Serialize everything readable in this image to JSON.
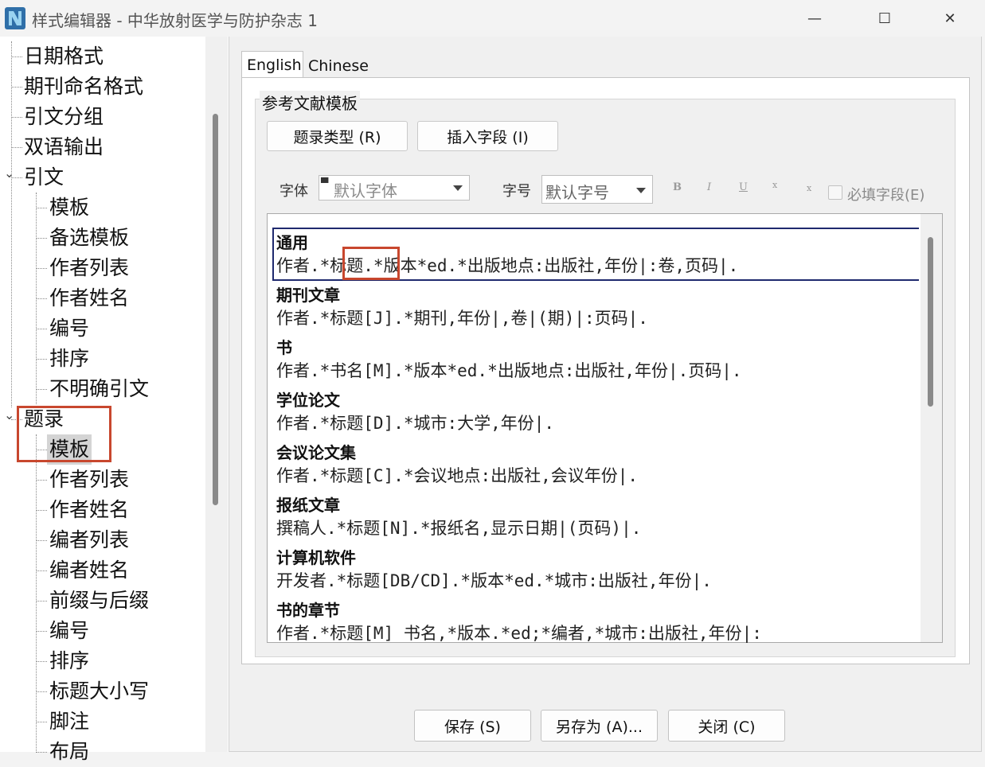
{
  "window": {
    "title": "样式编辑器 - 中华放射医学与防护杂志 1",
    "minimize": "—",
    "maximize": "☐",
    "close": "✕"
  },
  "tree": {
    "items": [
      {
        "label": "日期格式",
        "level": 0
      },
      {
        "label": "期刊命名格式",
        "level": 0
      },
      {
        "label": "引文分组",
        "level": 0
      },
      {
        "label": "双语输出",
        "level": 0
      },
      {
        "label": "引文",
        "level": 0,
        "expanded": true
      },
      {
        "label": "模板",
        "level": 1
      },
      {
        "label": "备选模板",
        "level": 1
      },
      {
        "label": "作者列表",
        "level": 1
      },
      {
        "label": "作者姓名",
        "level": 1
      },
      {
        "label": "编号",
        "level": 1
      },
      {
        "label": "排序",
        "level": 1
      },
      {
        "label": "不明确引文",
        "level": 1
      },
      {
        "label": "题录",
        "level": 0,
        "expanded": true
      },
      {
        "label": "模板",
        "level": 1,
        "selected": true
      },
      {
        "label": "作者列表",
        "level": 1
      },
      {
        "label": "作者姓名",
        "level": 1
      },
      {
        "label": "编者列表",
        "level": 1
      },
      {
        "label": "编者姓名",
        "level": 1
      },
      {
        "label": "前缀与后缀",
        "level": 1
      },
      {
        "label": "编号",
        "level": 1
      },
      {
        "label": "排序",
        "level": 1
      },
      {
        "label": "标题大小写",
        "level": 1
      },
      {
        "label": "脚注",
        "level": 1
      },
      {
        "label": "布局",
        "level": 1
      }
    ]
  },
  "tabs": [
    {
      "label": "English",
      "active": true
    },
    {
      "label": "Chinese",
      "active": false
    }
  ],
  "group": {
    "label": "参考文献模板",
    "ref_type_button": "题录类型 (R)",
    "insert_field_button": "插入字段 (I)"
  },
  "format": {
    "font_label": "字体",
    "font_value": "默认字体",
    "size_label": "字号",
    "size_value": "默认字号",
    "bold": "B",
    "italic": "I",
    "underline": "U",
    "superscript": "x",
    "subscript": "x",
    "required_label": "必填字段(E)"
  },
  "templates": [
    {
      "name": "通用",
      "template": "作者.*标题.*版本*ed.*出版地点:出版社,年份|:卷,页码|."
    },
    {
      "name": "期刊文章",
      "template": "作者.*标题[J].*期刊,年份|,卷|(期)|:页码|."
    },
    {
      "name": "书",
      "template": "作者.*书名[M].*版本*ed.*出版地点:出版社,年份|.页码|."
    },
    {
      "name": "学位论文",
      "template": "作者.*标题[D].*城市:大学,年份|."
    },
    {
      "name": "会议论文集",
      "template": "作者.*标题[C].*会议地点:出版社,会议年份|."
    },
    {
      "name": "报纸文章",
      "template": "撰稿人.*标题[N].*报纸名,显示日期|(页码)|."
    },
    {
      "name": "计算机软件",
      "template": "开发者.*标题[DB/CD].*版本*ed.*城市:出版社,年份|."
    },
    {
      "name": "书的章节",
      "template": "作者.*标题[M] 书名,*版本.*ed;*编者,*城市:出版社,年份|:"
    }
  ],
  "bottom": {
    "save": "保存 (S)",
    "save_as": "另存为 (A)...",
    "close": "关闭 (C)"
  }
}
